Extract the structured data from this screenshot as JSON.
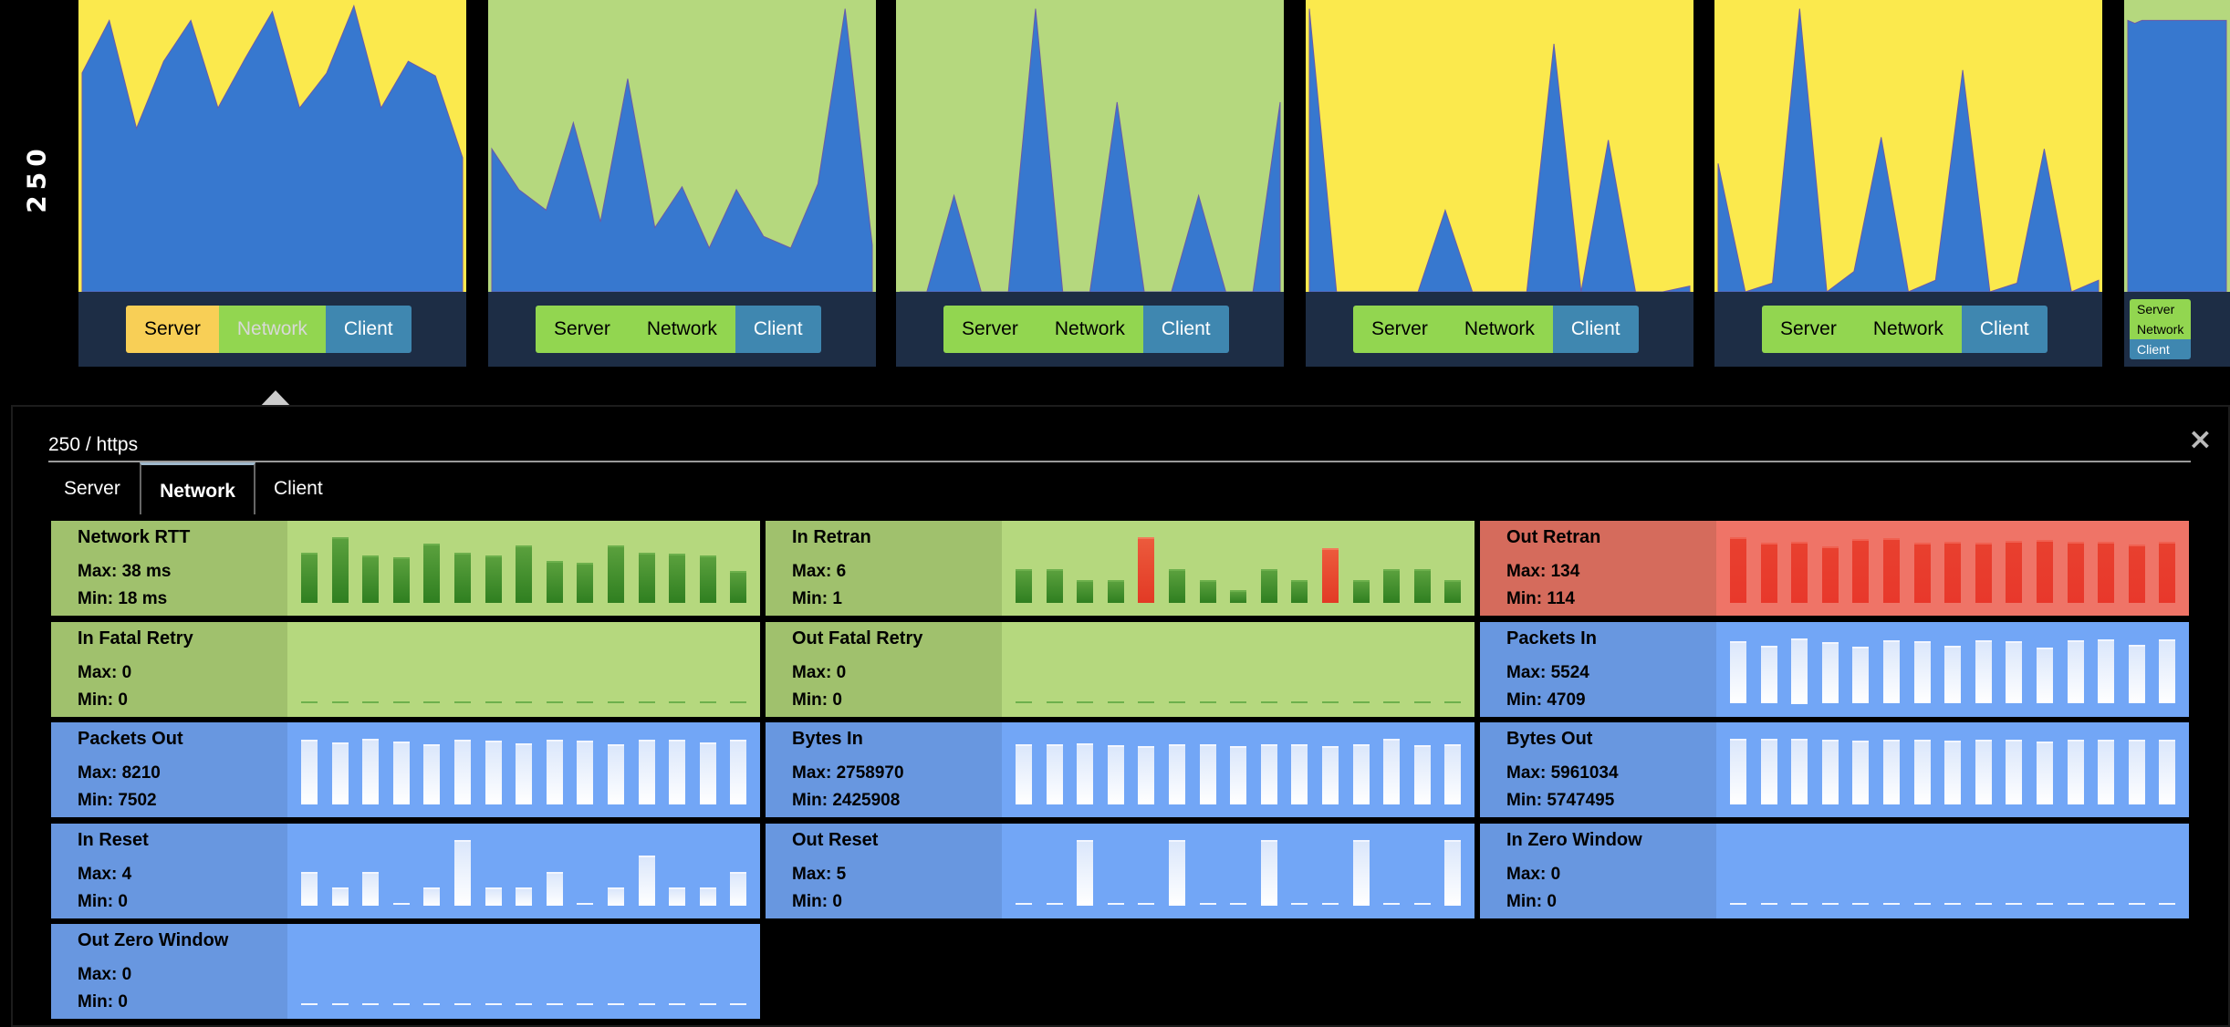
{
  "row_label": "250",
  "colors": {
    "server": "#fbe94d",
    "network": "#b5d87e",
    "client_area": "#3778cf",
    "footer": "#1d2d45"
  },
  "top_panels": [
    {
      "background": "server",
      "selected": "server",
      "values": [
        75,
        93,
        56,
        79,
        93,
        63,
        80,
        96,
        63,
        75,
        98,
        63,
        79,
        74,
        46
      ]
    },
    {
      "background": "network",
      "selected": "none",
      "values": [
        49,
        35,
        28,
        58,
        24,
        73,
        22,
        36,
        15,
        35,
        19,
        15,
        37,
        97,
        16
      ]
    },
    {
      "background": "network",
      "selected": "none",
      "values": [
        0,
        0,
        33,
        0,
        0,
        97,
        0,
        0,
        65,
        0,
        0,
        33,
        0,
        0,
        65
      ]
    },
    {
      "background": "server",
      "selected": "none",
      "values": [
        97,
        0,
        0,
        0,
        0,
        28,
        0,
        0,
        0,
        85,
        0,
        52,
        0,
        0,
        2
      ]
    },
    {
      "background": "server",
      "selected": "none",
      "values": [
        44,
        0,
        3,
        97,
        0,
        7,
        53,
        0,
        4,
        76,
        0,
        3,
        49,
        0,
        4
      ]
    },
    {
      "background": "network",
      "selected": "none",
      "values": [
        93,
        92,
        93,
        93,
        93,
        93,
        93,
        93,
        93,
        93,
        93,
        93,
        93,
        93,
        93
      ]
    }
  ],
  "buttons": {
    "server": "Server",
    "network": "Network",
    "client": "Client"
  },
  "detail": {
    "title": "250 / https",
    "close": "×",
    "tabs": [
      {
        "label": "Server",
        "active": false
      },
      {
        "label": "Network",
        "active": true
      },
      {
        "label": "Client",
        "active": false
      }
    ],
    "metrics": [
      {
        "title": "Network RTT",
        "max": "Max: 38 ms",
        "min": "Min: 18 ms",
        "theme": "green",
        "values": [
          29,
          38,
          27,
          26,
          34,
          29,
          27,
          33,
          24,
          23,
          33,
          29,
          28,
          27,
          18
        ]
      },
      {
        "title": "In Retran",
        "max": "Max: 6",
        "min": "Min: 1",
        "theme": "green",
        "alert_bars": [
          4,
          10
        ],
        "values": [
          3,
          3,
          2,
          2,
          6,
          3,
          2,
          1,
          3,
          2,
          5,
          2,
          3,
          3,
          2
        ]
      },
      {
        "title": "Out Retran",
        "max": "Max: 134",
        "min": "Min: 114",
        "theme": "red",
        "values": [
          134,
          122,
          125,
          114,
          130,
          133,
          122,
          125,
          122,
          127,
          129,
          125,
          125,
          118,
          125
        ]
      },
      {
        "title": "In Fatal Retry",
        "max": "Max: 0",
        "min": "Min: 0",
        "theme": "green",
        "values": [
          0,
          0,
          0,
          0,
          0,
          0,
          0,
          0,
          0,
          0,
          0,
          0,
          0,
          0,
          0
        ]
      },
      {
        "title": "Out Fatal Retry",
        "max": "Max: 0",
        "min": "Min: 0",
        "theme": "green",
        "values": [
          0,
          0,
          0,
          0,
          0,
          0,
          0,
          0,
          0,
          0,
          0,
          0,
          0,
          0,
          0
        ]
      },
      {
        "title": "Packets In",
        "max": "Max: 5524",
        "min": "Min: 4709",
        "theme": "blue",
        "values": [
          5274,
          4858,
          5524,
          5191,
          4775,
          5358,
          5274,
          4830,
          5358,
          5274,
          4709,
          5358,
          5441,
          4913,
          5441
        ]
      },
      {
        "title": "Packets Out",
        "max": "Max: 8210",
        "min": "Min: 7502",
        "theme": "blue",
        "values": [
          8094,
          7708,
          8210,
          7901,
          7554,
          8094,
          7978,
          7631,
          8094,
          8017,
          7502,
          8132,
          8094,
          7708,
          8132
        ]
      },
      {
        "title": "Bytes In",
        "max": "Max: 2758970",
        "min": "Min: 2425908",
        "theme": "blue",
        "values": [
          2523000,
          2509000,
          2552000,
          2483000,
          2442000,
          2524000,
          2524000,
          2442000,
          2524000,
          2524000,
          2425908,
          2524000,
          2758970,
          2483000,
          2524000
        ]
      },
      {
        "title": "Bytes Out",
        "max": "Max: 5961034",
        "min": "Min: 5747495",
        "theme": "blue",
        "values": [
          5961034,
          5931000,
          5931000,
          5841000,
          5751000,
          5871000,
          5871000,
          5811000,
          5871000,
          5871000,
          5747495,
          5871000,
          5901000,
          5901000,
          5841000
        ]
      },
      {
        "title": "In Reset",
        "max": "Max: 4",
        "min": "Min: 0",
        "theme": "blue",
        "values": [
          2,
          1,
          2,
          0,
          1,
          4,
          1,
          1,
          2,
          0,
          1,
          3,
          1,
          1,
          2
        ]
      },
      {
        "title": "Out Reset",
        "max": "Max: 5",
        "min": "Min: 0",
        "theme": "blue",
        "values": [
          0,
          0,
          5,
          0,
          0,
          5,
          0,
          0,
          5,
          0,
          0,
          5,
          0,
          0,
          5
        ]
      },
      {
        "title": "In Zero Window",
        "max": "Max: 0",
        "min": "Min: 0",
        "theme": "blue",
        "values": [
          0,
          0,
          0,
          0,
          0,
          0,
          0,
          0,
          0,
          0,
          0,
          0,
          0,
          0,
          0
        ]
      },
      {
        "title": "Out Zero Window",
        "max": "Max: 0",
        "min": "Min: 0",
        "theme": "blue",
        "values": [
          0,
          0,
          0,
          0,
          0,
          0,
          0,
          0,
          0,
          0,
          0,
          0,
          0,
          0,
          0
        ]
      }
    ]
  }
}
